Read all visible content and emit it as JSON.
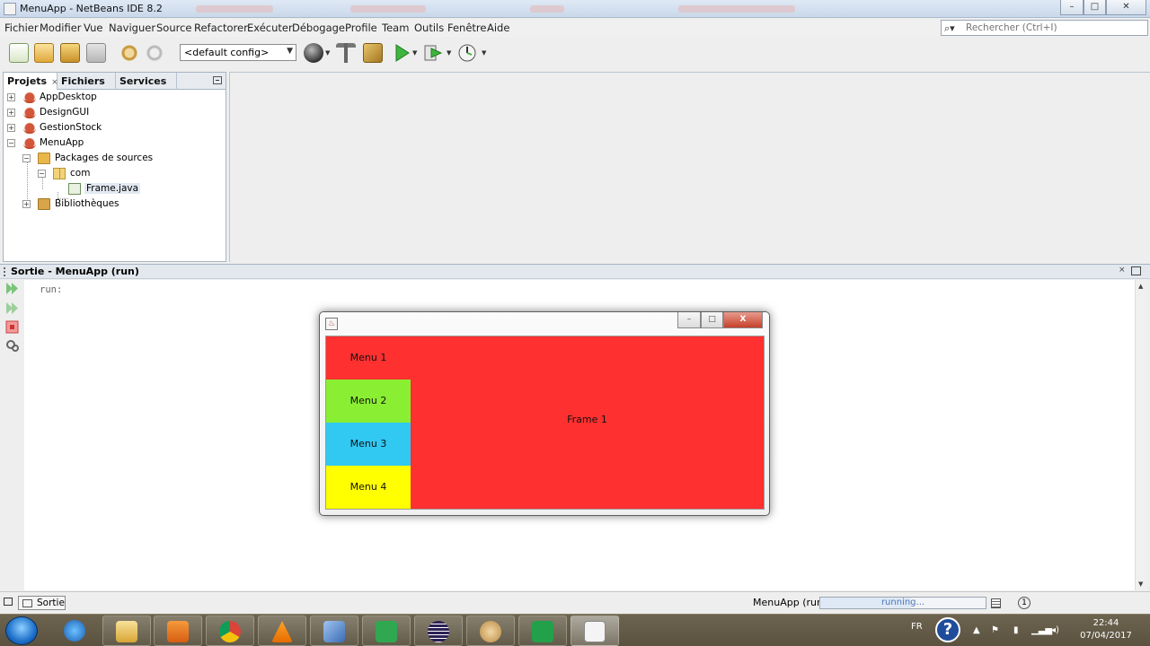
{
  "window": {
    "title": "MenuApp - NetBeans IDE 8.2",
    "minimize_label": "–",
    "maximize_label": "□",
    "close_label": "✕"
  },
  "menubar": {
    "items": [
      "Fichier",
      "Modifier",
      "Vue",
      "Naviguer",
      "Source",
      "Refactorer",
      "Exécuter",
      "Débogage",
      "Profile",
      "Team",
      "Outils",
      "Fenêtre",
      "Aide"
    ],
    "search_placeholder": "Rechercher (Ctrl+I)",
    "search_icon": "⌕▾"
  },
  "toolbar": {
    "config_value": "<default config>",
    "icons": [
      "new-file-icon",
      "new-project-icon",
      "open-project-icon",
      "close-project-icon",
      "undo-icon",
      "redo-icon",
      "globe-icon",
      "build-icon",
      "clean-build-icon",
      "run-icon",
      "debug-icon",
      "profile-icon"
    ]
  },
  "projects_panel": {
    "tabs": [
      "Projets",
      "Fichiers",
      "Services"
    ],
    "tab_close": "⨯",
    "tree": [
      {
        "label": "AppDesktop",
        "expander": "+"
      },
      {
        "label": "DesignGUI",
        "expander": "+"
      },
      {
        "label": "GestionStock",
        "expander": "+"
      },
      {
        "label": "MenuApp",
        "expander": "−"
      },
      {
        "label": "Packages de sources",
        "expander": "−"
      },
      {
        "label": "com",
        "expander": "−"
      },
      {
        "label": "Frame.java"
      },
      {
        "label": "Bibliothèques",
        "expander": "+"
      }
    ]
  },
  "output": {
    "title": "Sortie - MenuApp (run)",
    "close": "⨯",
    "text": "run:"
  },
  "statusbar": {
    "tab_label": "Sortie",
    "run_label": "MenuApp (run)",
    "progress_text": "running...",
    "progress": 0.55,
    "notif_count": "1"
  },
  "java_frame": {
    "icon_glyph": "♨",
    "minimize_label": "–",
    "maximize_label": "□",
    "close_label": "X",
    "menus": [
      {
        "label": "Menu 1",
        "color": "#ff3030"
      },
      {
        "label": "Menu 2",
        "color": "#8aee32"
      },
      {
        "label": "Menu 3",
        "color": "#31c8f2"
      },
      {
        "label": "Menu 4",
        "color": "#ffff00"
      }
    ],
    "content_label": "Frame 1"
  },
  "taskbar": {
    "apps": [
      "internet-explorer-icon",
      "file-explorer-icon",
      "media-player-icon",
      "chrome-icon",
      "vlc-icon",
      "virtualbox-icon",
      "camtasia-icon",
      "eclipse-icon",
      "paint-icon",
      "camtasia-recorder-icon",
      "java-icon"
    ],
    "lang": "FR",
    "help_glyph": "?",
    "time": "22:44",
    "date": "07/04/2017",
    "tray_up": "▲",
    "tray_flag": "⚑",
    "tray_battery": "▮",
    "tray_signal": "▁▃▅",
    "tray_volume": "◂)"
  },
  "colors": {
    "accent": "#3a73c4",
    "frame_red": "#ff3030"
  }
}
